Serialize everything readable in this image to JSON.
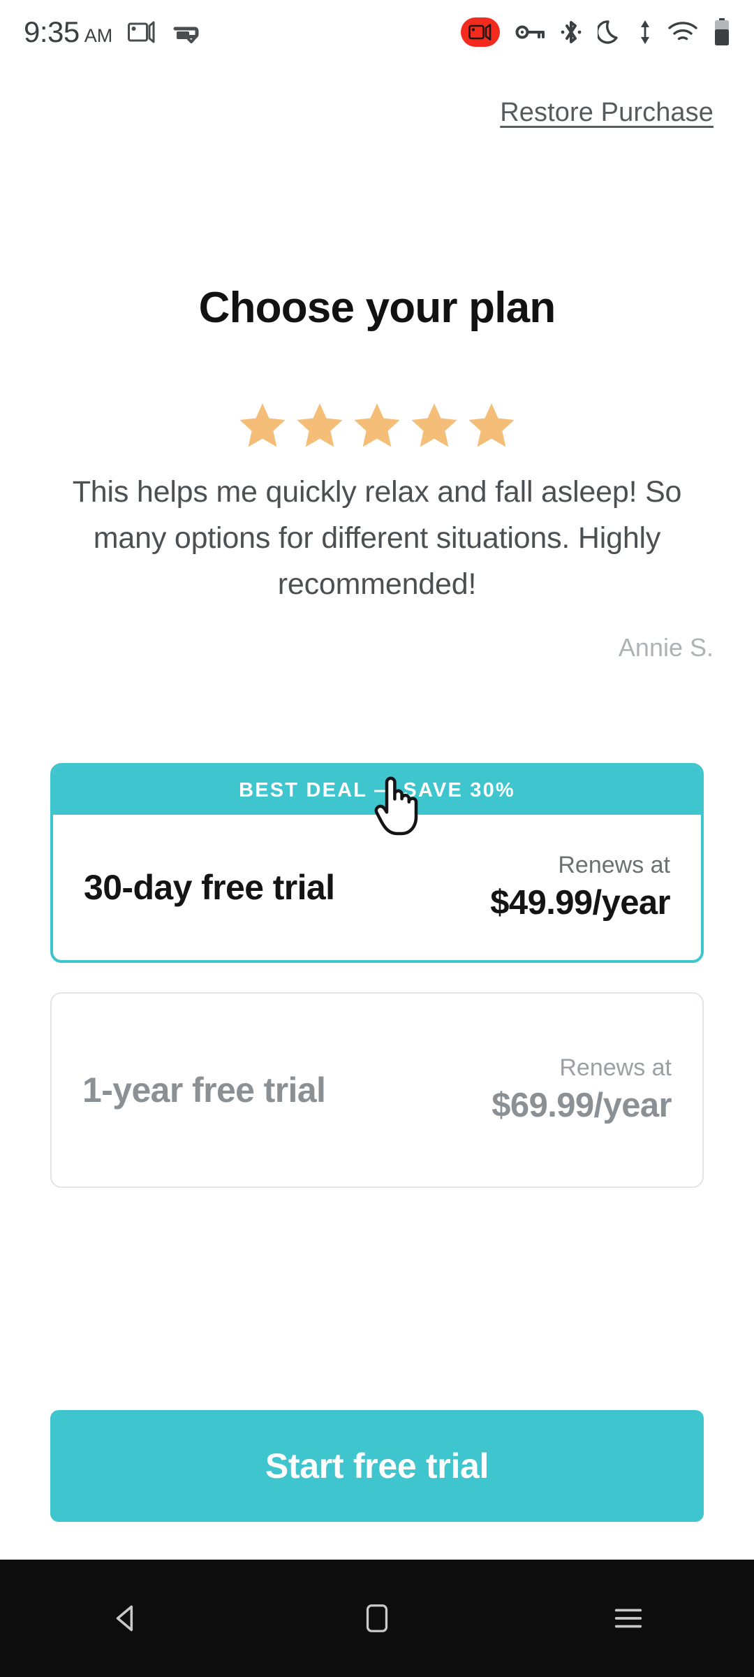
{
  "statusbar": {
    "time": "9:35",
    "ampm": "AM",
    "left_icons": [
      "screen-record-icon",
      "print-check-icon"
    ],
    "right_icons": [
      "recording-badge-icon",
      "vpn-key-icon",
      "bluetooth-icon",
      "do-not-disturb-icon",
      "data-transfer-icon",
      "wifi-icon",
      "battery-icon"
    ],
    "recording_badge_color": "#f32b1e"
  },
  "header": {
    "restore_label": "Restore Purchase"
  },
  "main": {
    "title": "Choose your plan",
    "rating": {
      "stars": 5,
      "star_color": "#f5be78"
    },
    "testimonial": {
      "text": "This helps me quickly relax and fall asleep! So many options for different situations. Highly recommended!",
      "author": "Annie S."
    },
    "plans": [
      {
        "badge": "BEST DEAL — SAVE 30%",
        "name": "30-day free trial",
        "renews_label": "Renews at",
        "price": "$49.99/year",
        "selected": true
      },
      {
        "badge": "",
        "name": "1-year free trial",
        "renews_label": "Renews at",
        "price": "$69.99/year",
        "selected": false
      }
    ],
    "cta_label": "Start free trial"
  },
  "navbar": {
    "back": "back-icon",
    "home": "home-icon",
    "recents": "recents-icon"
  },
  "theme": {
    "accent": "#3fc5cd",
    "text_dark": "#141414",
    "text_muted": "#8b9094"
  }
}
